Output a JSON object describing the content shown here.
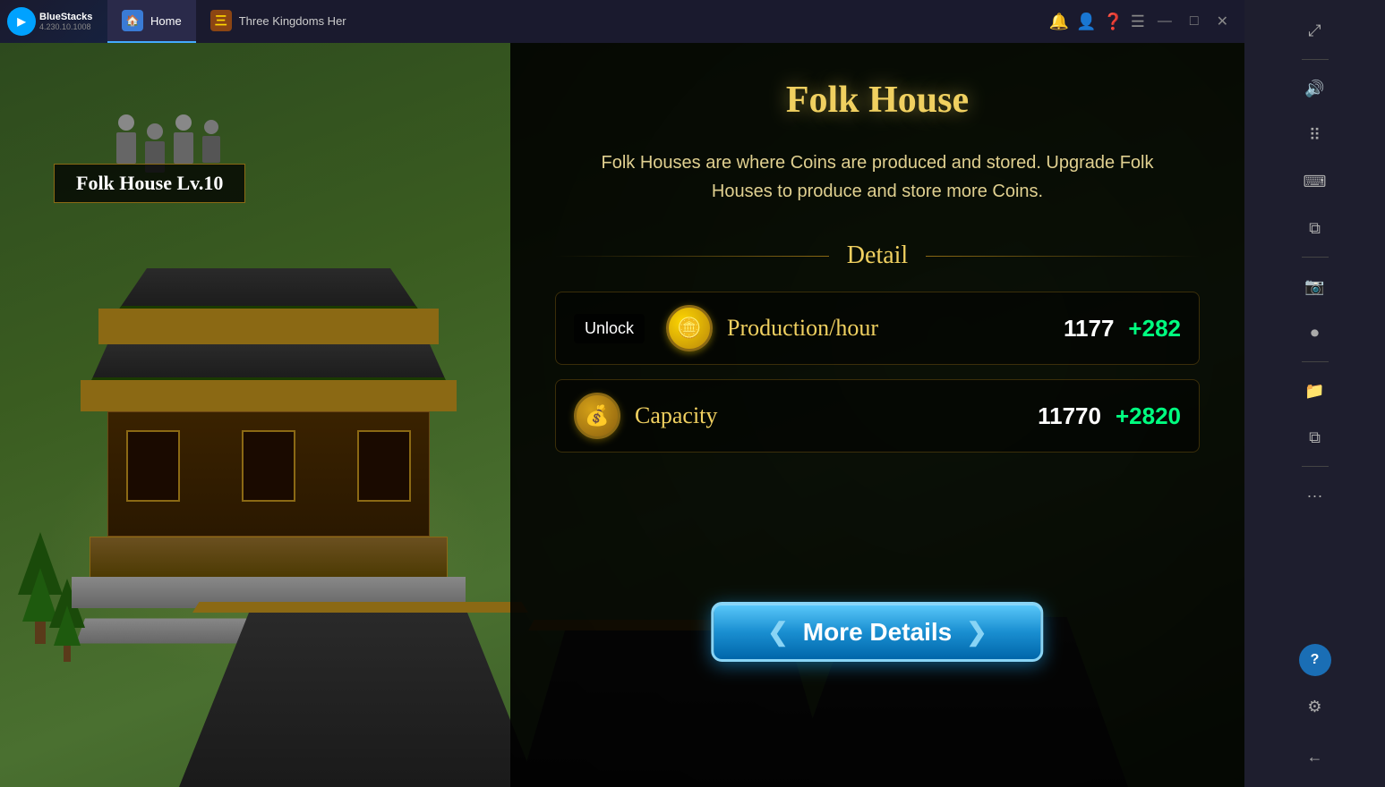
{
  "titlebar": {
    "app_name": "BlueStacks",
    "app_version": "4.230.10.1008",
    "tab_home": "Home",
    "tab_game": "Three Kingdoms Her",
    "window_controls": {
      "minimize": "—",
      "maximize": "□",
      "close": "✕",
      "back": "❮❮"
    }
  },
  "game": {
    "building_label": "Folk House  Lv.10",
    "panel": {
      "title": "Folk House",
      "description": "Folk Houses are where Coins are produced and stored. Upgrade Folk Houses to produce and store more Coins.",
      "detail_section_title": "Detail",
      "stats": [
        {
          "label": "Production/hour",
          "value": "1177",
          "bonus": "+282",
          "icon_type": "coin"
        },
        {
          "label": "Capacity",
          "value": "11770",
          "bonus": "+2820",
          "icon_type": "coin_bag"
        }
      ],
      "unlock_label": "Unlock",
      "more_details_btn": "More Details"
    }
  },
  "sidebar": {
    "icons": [
      {
        "name": "expand-icon",
        "symbol": "⤢"
      },
      {
        "name": "volume-icon",
        "symbol": "🔊"
      },
      {
        "name": "dots-grid-icon",
        "symbol": "⠿"
      },
      {
        "name": "keyboard-icon",
        "symbol": "⌨"
      },
      {
        "name": "copy-icon",
        "symbol": "⧉"
      },
      {
        "name": "camera-icon",
        "symbol": "📷"
      },
      {
        "name": "record-icon",
        "symbol": "⏺"
      },
      {
        "name": "folder-icon",
        "symbol": "📁"
      },
      {
        "name": "layers-icon",
        "symbol": "⧉"
      },
      {
        "name": "more-icon",
        "symbol": "···"
      },
      {
        "name": "help-icon",
        "symbol": "?"
      },
      {
        "name": "settings-icon",
        "symbol": "⚙"
      },
      {
        "name": "back-icon",
        "symbol": "←"
      }
    ]
  }
}
